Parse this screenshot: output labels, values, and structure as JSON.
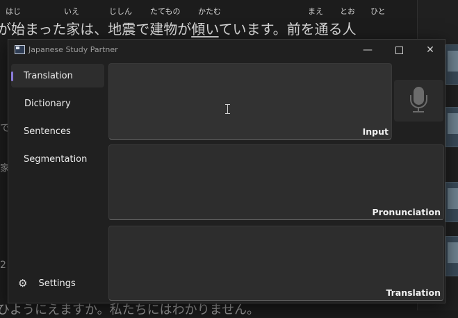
{
  "background": {
    "furigana": [
      "はじ",
      "いえ",
      "じしん",
      "たてもの",
      "かたむ",
      "まえ",
      "とお",
      "ひと"
    ],
    "line1_start": "が始まった家は、地震で建物が",
    "line1_underlined": "傾い",
    "line1_end": "ています。前を通る人",
    "side_text": [
      "で",
      "家",
      "2"
    ],
    "bottom_line": "ひようにえますか。私たちにはわかりません。"
  },
  "window": {
    "title": "Japanese Study Partner",
    "controls": {
      "minimize": "—",
      "close": "✕"
    }
  },
  "sidebar": {
    "items": [
      {
        "label": "Translation",
        "active": true
      },
      {
        "label": "Dictionary",
        "active": false
      },
      {
        "label": "Sentences",
        "active": false
      },
      {
        "label": "Segmentation",
        "active": false
      }
    ],
    "settings_label": "Settings",
    "settings_icon": "gear-icon"
  },
  "main": {
    "input_label": "Input",
    "input_value": "",
    "pronunciation_label": "Pronunciation",
    "translation_label": "Translation",
    "mic_icon": "microphone-icon"
  },
  "colors": {
    "accent": "#8a7bd8",
    "window_bg": "#202020",
    "panel_bg": "#2d2d2d"
  }
}
